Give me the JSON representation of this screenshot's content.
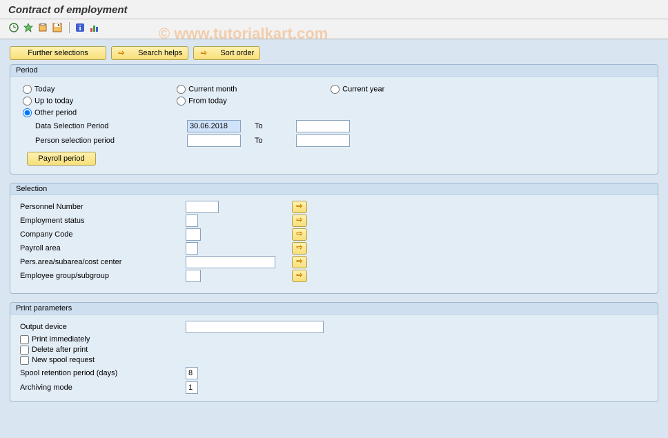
{
  "header": {
    "title": "Contract of employment"
  },
  "watermark": "© www.tutorialkart.com",
  "toolbar": {
    "icons": [
      "execute",
      "variant",
      "jobs",
      "save",
      "info",
      "stats"
    ]
  },
  "topButtons": {
    "further": "Further selections",
    "search": "Search helps",
    "sort": "Sort order"
  },
  "period": {
    "header": "Period",
    "radios": {
      "today": "Today",
      "current_month": "Current month",
      "current_year": "Current year",
      "up_to_today": "Up to today",
      "from_today": "From today",
      "other": "Other period"
    },
    "selected": "other",
    "data_selection_label": "Data Selection Period",
    "data_selection_value": "30.06.2018",
    "data_selection_to_label": "To",
    "data_selection_to_value": "",
    "person_selection_label": "Person selection period",
    "person_selection_value": "",
    "person_selection_to_label": "To",
    "person_selection_to_value": "",
    "payroll_period_btn": "Payroll period"
  },
  "selection": {
    "header": "Selection",
    "rows": {
      "personnel_number": {
        "label": "Personnel Number",
        "value": ""
      },
      "employment_status": {
        "label": "Employment status",
        "value": ""
      },
      "company_code": {
        "label": "Company Code",
        "value": ""
      },
      "payroll_area": {
        "label": "Payroll area",
        "value": ""
      },
      "pers_area": {
        "label": "Pers.area/subarea/cost center",
        "value": ""
      },
      "employee_group": {
        "label": "Employee group/subgroup",
        "value": ""
      }
    }
  },
  "print": {
    "header": "Print parameters",
    "output_device_label": "Output device",
    "output_device_value": "",
    "print_immediately": "Print immediately",
    "delete_after_print": "Delete after print",
    "new_spool_request": "New spool request",
    "spool_retention_label": "Spool retention period (days)",
    "spool_retention_value": "8",
    "archiving_mode_label": "Archiving mode",
    "archiving_mode_value": "1"
  }
}
